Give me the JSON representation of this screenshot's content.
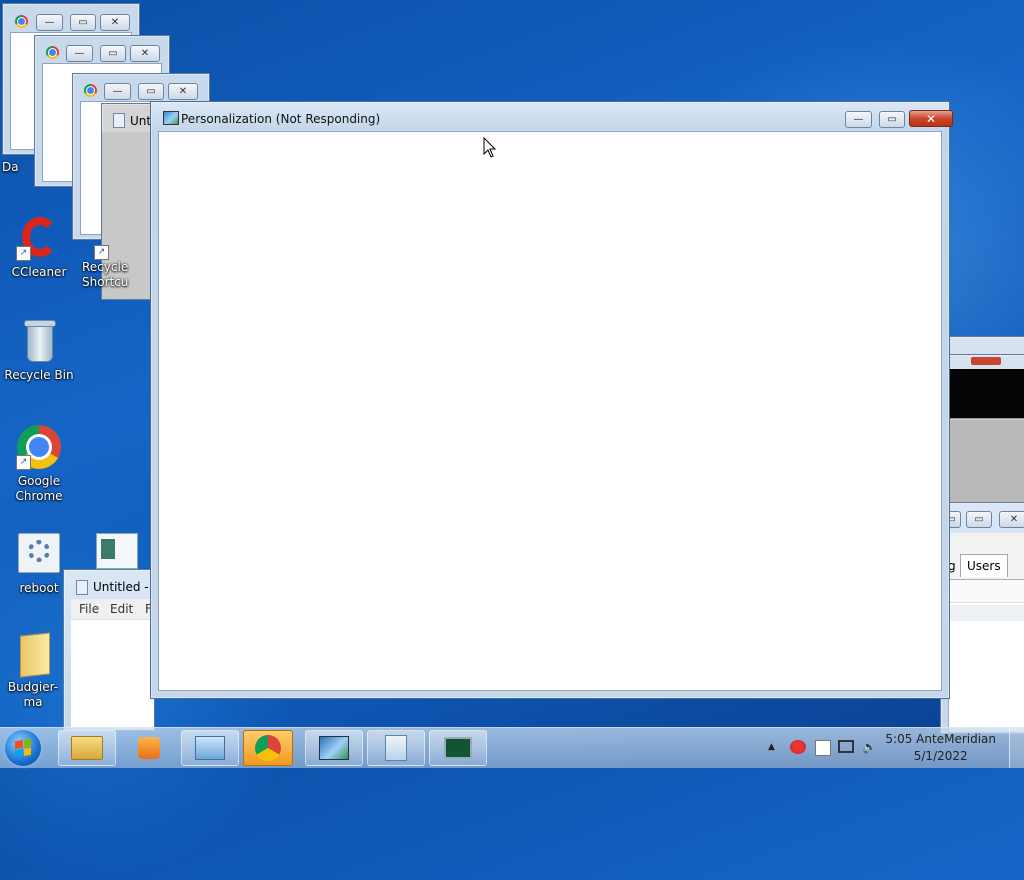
{
  "desktop": {
    "icons": [
      {
        "label": "CCleaner"
      },
      {
        "label": "Recycle Bin"
      },
      {
        "label": "Google Chrome"
      },
      {
        "label": "reboot"
      },
      {
        "label": "Budgier-ma"
      },
      {
        "label": "Recycle Bin - Shortcut",
        "visible": "Recycle Shortcu"
      },
      {
        "label": "Da"
      }
    ]
  },
  "background_windows": {
    "notepad_title": "Untitled -",
    "notepad_title_partial": "Unt",
    "notepad_menu": [
      "File",
      "Edit",
      "F"
    ],
    "task_manager_tab": "Users",
    "task_manager_tab_partial": "g"
  },
  "personalization_window": {
    "title": "Personalization (Not Responding)",
    "status": "Not Responding"
  },
  "taskbar": {
    "clock_time": "5:05 AnteMeridian",
    "clock_date": "5/1/2022",
    "tray_chevron": "▲"
  },
  "colors": {
    "desktop": "#1565c6",
    "close_button": "#c9462c",
    "active_taskbar": "#f09a1e"
  }
}
